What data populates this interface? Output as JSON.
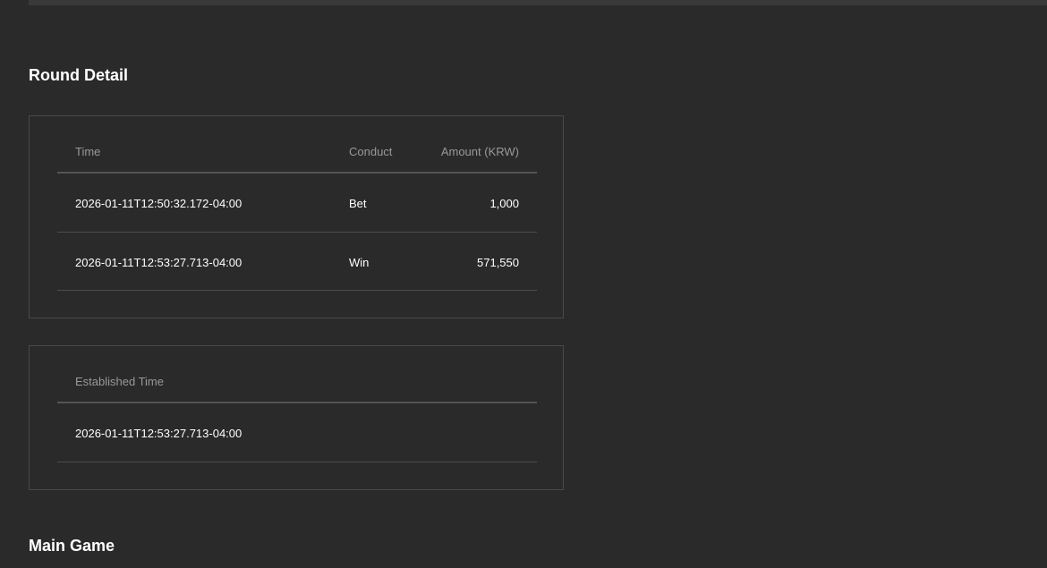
{
  "round_detail": {
    "title": "Round Detail",
    "table": {
      "columns": {
        "time": "Time",
        "conduct": "Conduct",
        "amount": "Amount (KRW)"
      },
      "rows": [
        {
          "time": "2026-01-11T12:50:32.172-04:00",
          "conduct": "Bet",
          "amount": "1,000"
        },
        {
          "time": "2026-01-11T12:53:27.713-04:00",
          "conduct": "Win",
          "amount": "571,550"
        }
      ]
    },
    "established": {
      "header": "Established Time",
      "value": "2026-01-11T12:53:27.713-04:00"
    }
  },
  "main_game": {
    "title": "Main Game"
  }
}
